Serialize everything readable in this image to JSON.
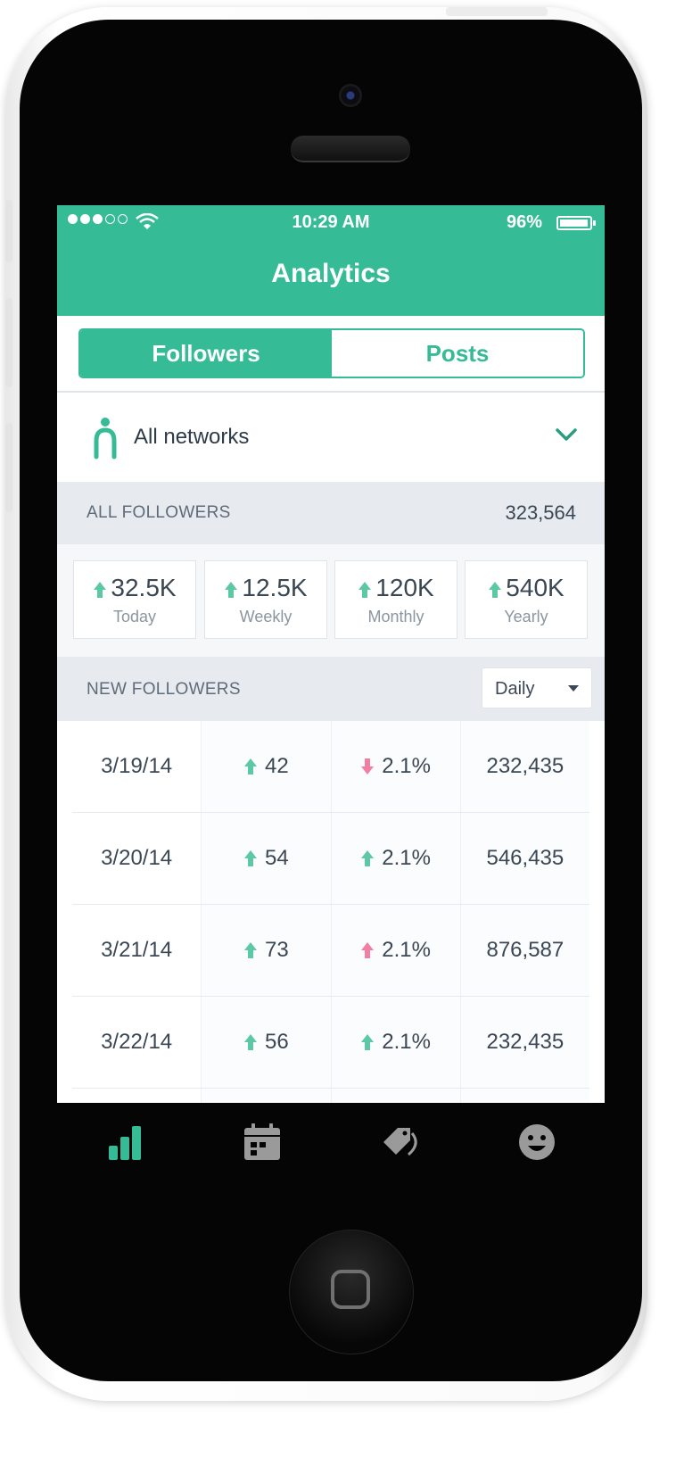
{
  "status_bar": {
    "signal_dots": 5,
    "signal_filled": 3,
    "time": "10:29 AM",
    "battery_percent_label": "96%",
    "battery_level": 0.96
  },
  "header": {
    "title": "Analytics"
  },
  "segmented": {
    "tabs": [
      {
        "label": "Followers",
        "active": true
      },
      {
        "label": "Posts",
        "active": false
      }
    ]
  },
  "network_selector": {
    "label": "All networks",
    "icon": "person-icon",
    "chevron": "chevron-down-icon"
  },
  "all_followers": {
    "label": "ALL FOLLOWERS",
    "total": "323,564",
    "stats": [
      {
        "value": "32.5K",
        "label": "Today",
        "trend": "up"
      },
      {
        "value": "12.5K",
        "label": "Weekly",
        "trend": "up"
      },
      {
        "value": "120K",
        "label": "Monthly",
        "trend": "up"
      },
      {
        "value": "540K",
        "label": "Yearly",
        "trend": "up"
      }
    ]
  },
  "new_followers": {
    "label": "NEW FOLLOWERS",
    "period": "Daily",
    "rows": [
      {
        "date": "3/19/14",
        "count": "42",
        "count_trend": "up",
        "pct": "2.1%",
        "pct_trend": "down",
        "total": "232,435"
      },
      {
        "date": "3/20/14",
        "count": "54",
        "count_trend": "up",
        "pct": "2.1%",
        "pct_trend": "up",
        "total": "546,435"
      },
      {
        "date": "3/21/14",
        "count": "73",
        "count_trend": "up",
        "pct": "2.1%",
        "pct_trend": "up-pink",
        "total": "876,587"
      },
      {
        "date": "3/22/14",
        "count": "56",
        "count_trend": "up",
        "pct": "2.1%",
        "pct_trend": "up",
        "total": "232,435"
      }
    ]
  },
  "tab_bar": {
    "tabs": [
      {
        "icon": "bar-chart-icon",
        "active": true
      },
      {
        "icon": "calendar-icon",
        "active": false
      },
      {
        "icon": "tag-icon",
        "active": false
      },
      {
        "icon": "smiley-icon",
        "active": false
      }
    ]
  },
  "colors": {
    "accent": "#36bb97",
    "up": "#5cc8a4",
    "down": "#f27ea4",
    "text": "#3b4754"
  }
}
